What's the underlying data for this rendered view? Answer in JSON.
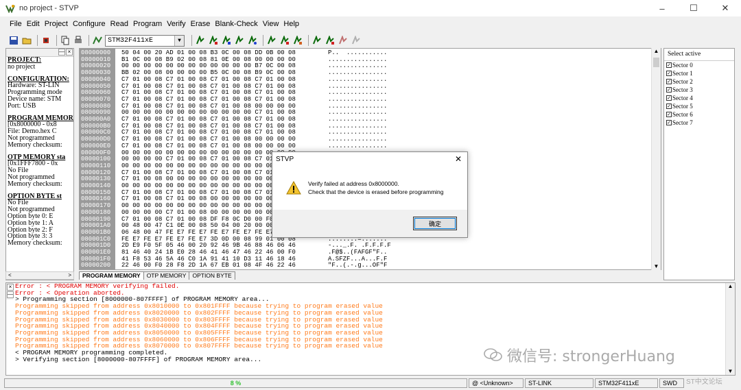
{
  "window": {
    "title": "no project - STVP",
    "controls": [
      "minimize",
      "maximize",
      "close"
    ]
  },
  "menu": [
    {
      "label": "File"
    },
    {
      "label": "Edit"
    },
    {
      "label": "Project"
    },
    {
      "label": "Configure"
    },
    {
      "label": "Read"
    },
    {
      "label": "Program"
    },
    {
      "label": "Verify"
    },
    {
      "label": "Erase"
    },
    {
      "label": "Blank-Check"
    },
    {
      "label": "View"
    },
    {
      "label": "Help"
    }
  ],
  "toolbar": {
    "device": "STM32F411xE",
    "icons": [
      "save-icon",
      "open-icon",
      "chip-icon",
      "copy-icon",
      "print-icon",
      "program-icon"
    ]
  },
  "left_panel": {
    "lines": [
      {
        "text": "PROJECT:",
        "heading": true
      },
      {
        "text": "no project",
        "heading": false
      },
      {
        "text": "",
        "gap": true
      },
      {
        "text": "CONFIGURATION:",
        "heading": true
      },
      {
        "text": "Hardware: ST-LIN",
        "heading": false
      },
      {
        "text": "Programming mode",
        "heading": false
      },
      {
        "text": "Device name: STM",
        "heading": false
      },
      {
        "text": "Port: USB",
        "heading": false
      },
      {
        "text": "",
        "gap": true
      },
      {
        "text": "PROGRAM MEMORY",
        "heading": true
      },
      {
        "text": "[0x8000000 - 0x8",
        "heading": false
      },
      {
        "text": "File: Demo.hex C",
        "heading": false
      },
      {
        "text": "Not programmed",
        "heading": false
      },
      {
        "text": "Memory checksum:",
        "heading": false
      },
      {
        "text": "",
        "gap": true
      },
      {
        "text": "OTP MEMORY sta",
        "heading": true
      },
      {
        "text": "[0x1FFF7800 - 0x",
        "heading": false
      },
      {
        "text": "No File",
        "heading": false
      },
      {
        "text": "Not programmed",
        "heading": false
      },
      {
        "text": "Memory checksum:",
        "heading": false
      },
      {
        "text": "",
        "gap": true
      },
      {
        "text": "OPTION BYTE st",
        "heading": true
      },
      {
        "text": "No File",
        "heading": false
      },
      {
        "text": "Not programmed",
        "heading": false
      },
      {
        "text": "Option byte 0: E",
        "heading": false
      },
      {
        "text": "Option byte 1: A",
        "heading": false
      },
      {
        "text": "Option byte 2: F",
        "heading": false
      },
      {
        "text": "Option byte 3: 3",
        "heading": false
      },
      {
        "text": "Memory checksum:",
        "heading": false
      }
    ]
  },
  "memory": {
    "rows": [
      {
        "addr": "08000000",
        "hex": "50 04 00 20 AD 01 00 08 B3 0C 00 08 DD 0B 00 08",
        "ascii": "P..  ..........."
      },
      {
        "addr": "08000010",
        "hex": "B1 0C 00 08 B9 02 00 08 81 0E 00 08 00 00 00 00",
        "ascii": "................"
      },
      {
        "addr": "08000020",
        "hex": "00 00 00 00 00 00 00 00 00 00 00 00 B7 0C 00 08",
        "ascii": "................"
      },
      {
        "addr": "08000030",
        "hex": "BB 02 00 08 00 00 00 00 B5 0C 00 08 B9 0C 00 08",
        "ascii": "................"
      },
      {
        "addr": "08000040",
        "hex": "C7 01 00 08 C7 01 00 08 C7 01 00 08 C7 01 00 08",
        "ascii": "................"
      },
      {
        "addr": "08000050",
        "hex": "C7 01 00 08 C7 01 00 08 C7 01 00 08 C7 01 00 08",
        "ascii": "................"
      },
      {
        "addr": "08000060",
        "hex": "C7 01 00 08 C7 01 00 08 C7 01 00 08 C7 01 00 08",
        "ascii": "................"
      },
      {
        "addr": "08000070",
        "hex": "C7 01 00 08 C7 01 00 08 C7 01 00 08 C7 01 00 08",
        "ascii": "................"
      },
      {
        "addr": "08000080",
        "hex": "C7 01 00 08 C7 01 00 08 C7 01 00 08 00 00 00 00",
        "ascii": "................"
      },
      {
        "addr": "08000090",
        "hex": "00 00 00 00 00 00 00 00 00 00 00 00 C7 01 00 08",
        "ascii": "................"
      },
      {
        "addr": "080000A0",
        "hex": "C7 01 00 08 C7 01 00 08 C7 01 00 08 C7 01 00 08",
        "ascii": "................"
      },
      {
        "addr": "080000B0",
        "hex": "C7 01 00 08 C7 01 00 08 C7 01 00 08 C7 01 00 08",
        "ascii": "................"
      },
      {
        "addr": "080000C0",
        "hex": "C7 01 00 08 C7 01 00 08 C7 01 00 08 C7 01 00 08",
        "ascii": "................"
      },
      {
        "addr": "080000D0",
        "hex": "C7 01 00 08 C7 01 00 08 C7 01 00 08 00 00 00 00",
        "ascii": "................"
      },
      {
        "addr": "080000E0",
        "hex": "C7 01 00 08 C7 01 00 08 C7 01 00 08 00 00 00 00",
        "ascii": "................"
      },
      {
        "addr": "080000F0",
        "hex": "00 00 00 00 00 00 00 00 00 00 00 00 00 00 00 00",
        "ascii": "................"
      },
      {
        "addr": "08000100",
        "hex": "00 00 00 00 C7 01 00 08 C7 01 00 08 C7 01 00 08",
        "ascii": "................"
      },
      {
        "addr": "08000110",
        "hex": "00 00 00 00 00 00 00 00 00 00 00 00 00 00 00 00",
        "ascii": "................"
      },
      {
        "addr": "08000120",
        "hex": "C7 01 00 08 C7 01 00 08 C7 01 00 08 C7 01 00 08",
        "ascii": "................"
      },
      {
        "addr": "08000130",
        "hex": "C7 01 00 08 00 00 00 00 00 00 00 00 00 00 00 00",
        "ascii": "................"
      },
      {
        "addr": "08000140",
        "hex": "00 00 00 00 00 00 00 00 00 00 00 00 00 00 00 00",
        "ascii": "................"
      },
      {
        "addr": "08000150",
        "hex": "C7 01 00 08 C7 01 00 08 C7 01 00 08 C7 01 00 08",
        "ascii": "................"
      },
      {
        "addr": "08000160",
        "hex": "C7 01 00 08 C7 01 00 08 00 00 00 00 00 00 00 00",
        "ascii": "................"
      },
      {
        "addr": "08000170",
        "hex": "00 00 00 00 00 00 00 00 00 00 00 00 00 00 00 00",
        "ascii": "................"
      },
      {
        "addr": "08000180",
        "hex": "00 00 00 00 C7 01 00 08 00 00 00 00 00 00 00 00",
        "ascii": "................"
      },
      {
        "addr": "08000190",
        "hex": "C7 01 00 08 C7 01 00 08 DF F8 0C D0 00 F0 00 00",
        "ascii": "................"
      },
      {
        "addr": "080001A0",
        "hex": "00 48 00 47 C1 0E 00 08 50 04 00 20 00 00 00 00",
        "ascii": "................"
      },
      {
        "addr": "080001B0",
        "hex": "06 48 00 47 FE E7 FE E7 FE E7 FE E7 FE E7 FE E7",
        "ascii": "................"
      },
      {
        "addr": "080001C0",
        "hex": "FE E7 FE E7 FE E7 FE E7 3D 0D 00 08 99 01 00 08",
        "ascii": "........=......."
      },
      {
        "addr": "080001D0",
        "hex": "2D E9 F0 5F 05 46 00 20 92 46 9B 46 88 46 06 46",
        "ascii": "-..._.F. .F.F.F.F"
      },
      {
        "addr": "080001E0",
        "hex": "81 46 40 24 1B E0 28 46 41 46 47 46 22 46 00 F0",
        "ascii": ".F@$..(FAFGF\"F.."
      },
      {
        "addr": "080001F0",
        "hex": "41 F8 53 46 5A 46 C0 1A 91 41 10 D3 11 46 18 46",
        "ascii": "A.SFZF...A...F.F"
      },
      {
        "addr": "08000200",
        "hex": "22 46 00 F0 28 F8 2D 1A 67 EB 01 08 4F 46 22 46",
        "ascii": "\"F..(.-.g...OF\"F"
      }
    ]
  },
  "tabs": [
    {
      "label": "PROGRAM MEMORY",
      "active": true
    },
    {
      "label": "OTP MEMORY",
      "active": false
    },
    {
      "label": "OPTION BYTE",
      "active": false
    }
  ],
  "sectors": {
    "header": "Select active",
    "items": [
      {
        "label": "Sector 0",
        "checked": true
      },
      {
        "label": "Sector 1",
        "checked": true
      },
      {
        "label": "Sector 2",
        "checked": true
      },
      {
        "label": "Sector 3",
        "checked": true
      },
      {
        "label": "Sector 4",
        "checked": true
      },
      {
        "label": "Sector 5",
        "checked": true
      },
      {
        "label": "Sector 6",
        "checked": true
      },
      {
        "label": "Sector 7",
        "checked": true
      }
    ]
  },
  "log": {
    "lines": [
      {
        "text": "Error : < PROGRAM MEMORY verifying failed.",
        "color": "#e00000"
      },
      {
        "text": "Error : < Operation aborted.",
        "color": "#e00000"
      },
      {
        "text": "> Programming section [8000000-807FFFF] of PROGRAM MEMORY area...",
        "color": "#000000"
      },
      {
        "text": "Programming skipped from address 0x8010000 to 0x801FFFF because trying to program erased value",
        "color": "#ff7a1a"
      },
      {
        "text": "Programming skipped from address 0x8020000 to 0x802FFFF because trying to program erased value",
        "color": "#ff7a1a"
      },
      {
        "text": "Programming skipped from address 0x8030000 to 0x803FFFF because trying to program erased value",
        "color": "#ff7a1a"
      },
      {
        "text": "Programming skipped from address 0x8040000 to 0x804FFFF because trying to program erased value",
        "color": "#ff7a1a"
      },
      {
        "text": "Programming skipped from address 0x8050000 to 0x805FFFF because trying to program erased value",
        "color": "#ff7a1a"
      },
      {
        "text": "Programming skipped from address 0x8060000 to 0x806FFFF because trying to program erased value",
        "color": "#ff7a1a"
      },
      {
        "text": "Programming skipped from address 0x8070000 to 0x807FFFF because trying to program erased value",
        "color": "#ff7a1a"
      },
      {
        "text": "< PROGRAM MEMORY programming completed.",
        "color": "#000000"
      },
      {
        "text": "> Verifying section [8000000-807FFFF] of PROGRAM MEMORY area...",
        "color": "#000000"
      }
    ]
  },
  "status": {
    "progress": "8 %",
    "port": "@ <Unknown>",
    "hardware": "ST-LINK",
    "device": "STM32F411xE",
    "mode": "SWD"
  },
  "dialog": {
    "title": "STVP",
    "line1": "Verify failed at address 0x8000000.",
    "line2": "Check that the device is erased before programming",
    "ok": "确定"
  },
  "watermark": {
    "text": "微信号: strongerHuang",
    "site": "ST中文论坛"
  }
}
